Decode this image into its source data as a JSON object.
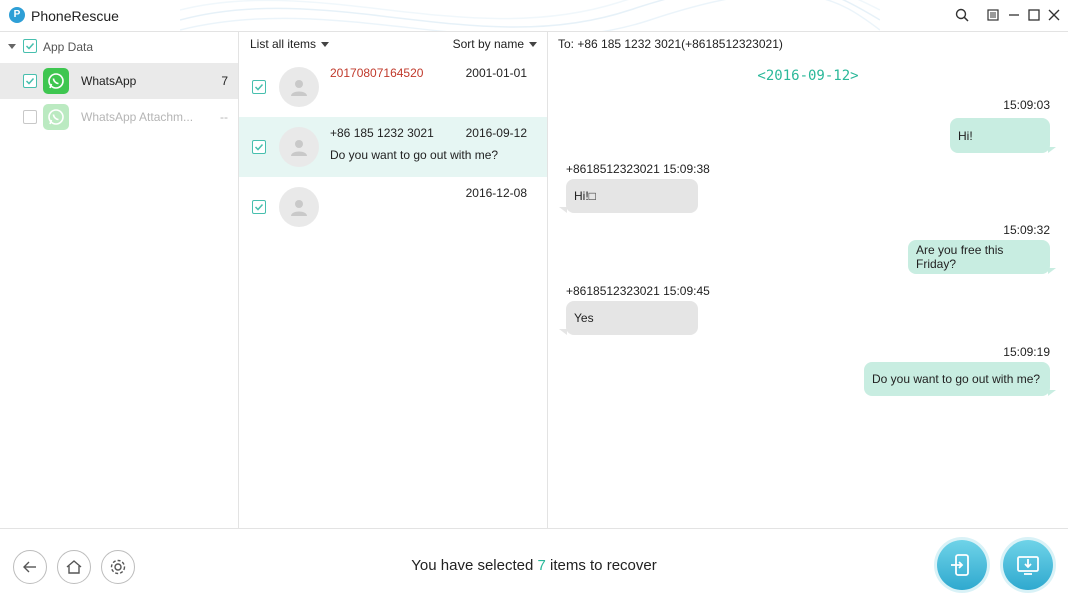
{
  "app": {
    "title": "PhoneRescue",
    "logo_letter": "P"
  },
  "sidebar": {
    "root_label": "App Data",
    "items": [
      {
        "label": "WhatsApp",
        "count": "7",
        "checked": true,
        "selected": true
      },
      {
        "label": "WhatsApp Attachm...",
        "count": "--",
        "checked": false,
        "selected": false
      }
    ]
  },
  "list": {
    "filter_label": "List all items",
    "sort_label": "Sort by name",
    "conversations": [
      {
        "name": "20170807164520",
        "date": "2001-01-01",
        "preview": ""
      },
      {
        "name": "+86 185 1232 3021",
        "date": "2016-09-12",
        "preview": "Do you want to go out with me?"
      },
      {
        "name": "",
        "date": "2016-12-08",
        "preview": ""
      }
    ]
  },
  "chat": {
    "to_label": "To: +86 185 1232 3021(+8618512323021)",
    "date_separator": "<2016-09-12>",
    "messages": [
      {
        "direction": "out",
        "meta": "15:09:03",
        "text": "Hi!"
      },
      {
        "direction": "in",
        "meta": "+8618512323021 15:09:38",
        "text": "Hi!□"
      },
      {
        "direction": "out",
        "meta": "15:09:32",
        "text": "Are you free this Friday?"
      },
      {
        "direction": "in",
        "meta": "+8618512323021 15:09:45",
        "text": "Yes"
      },
      {
        "direction": "out",
        "meta": "15:09:19",
        "text": "Do you want to go out with me?"
      }
    ]
  },
  "footer": {
    "status_prefix": "You have selected ",
    "selected_count": "7",
    "status_suffix": " items to recover"
  },
  "colors": {
    "accent": "#2bb89a",
    "out_bubble": "#c8ede1",
    "in_bubble": "#e5e5e5",
    "action": "#2fa9cf"
  }
}
